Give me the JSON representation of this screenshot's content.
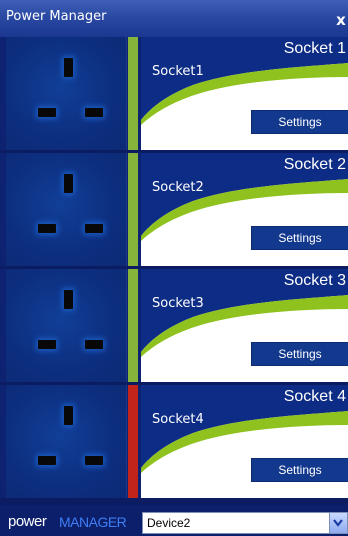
{
  "window": {
    "title": "Power Manager",
    "close_glyph": "x"
  },
  "sockets": [
    {
      "name": "Socket 1",
      "label": "Socket1",
      "settings_label": "Settings",
      "status_color": "#86b43a"
    },
    {
      "name": "Socket 2",
      "label": "Socket2",
      "settings_label": "Settings",
      "status_color": "#86b43a"
    },
    {
      "name": "Socket 3",
      "label": "Socket3",
      "settings_label": "Settings",
      "status_color": "#86b43a"
    },
    {
      "name": "Socket 4",
      "label": "Socket4",
      "settings_label": "Settings",
      "status_color": "#c2231a"
    }
  ],
  "footer": {
    "logo_power": "power",
    "logo_manager": "MANAGER",
    "device_selected": "Device2"
  },
  "colors": {
    "background": "#0d2270",
    "panel_blue": "#0d2c86",
    "swoosh_green": "#8fc21f",
    "button": "#13398f"
  },
  "icons": {
    "close": "close-icon",
    "dropdown": "chevron-down-icon",
    "socket": "uk-plug-socket-icon"
  }
}
